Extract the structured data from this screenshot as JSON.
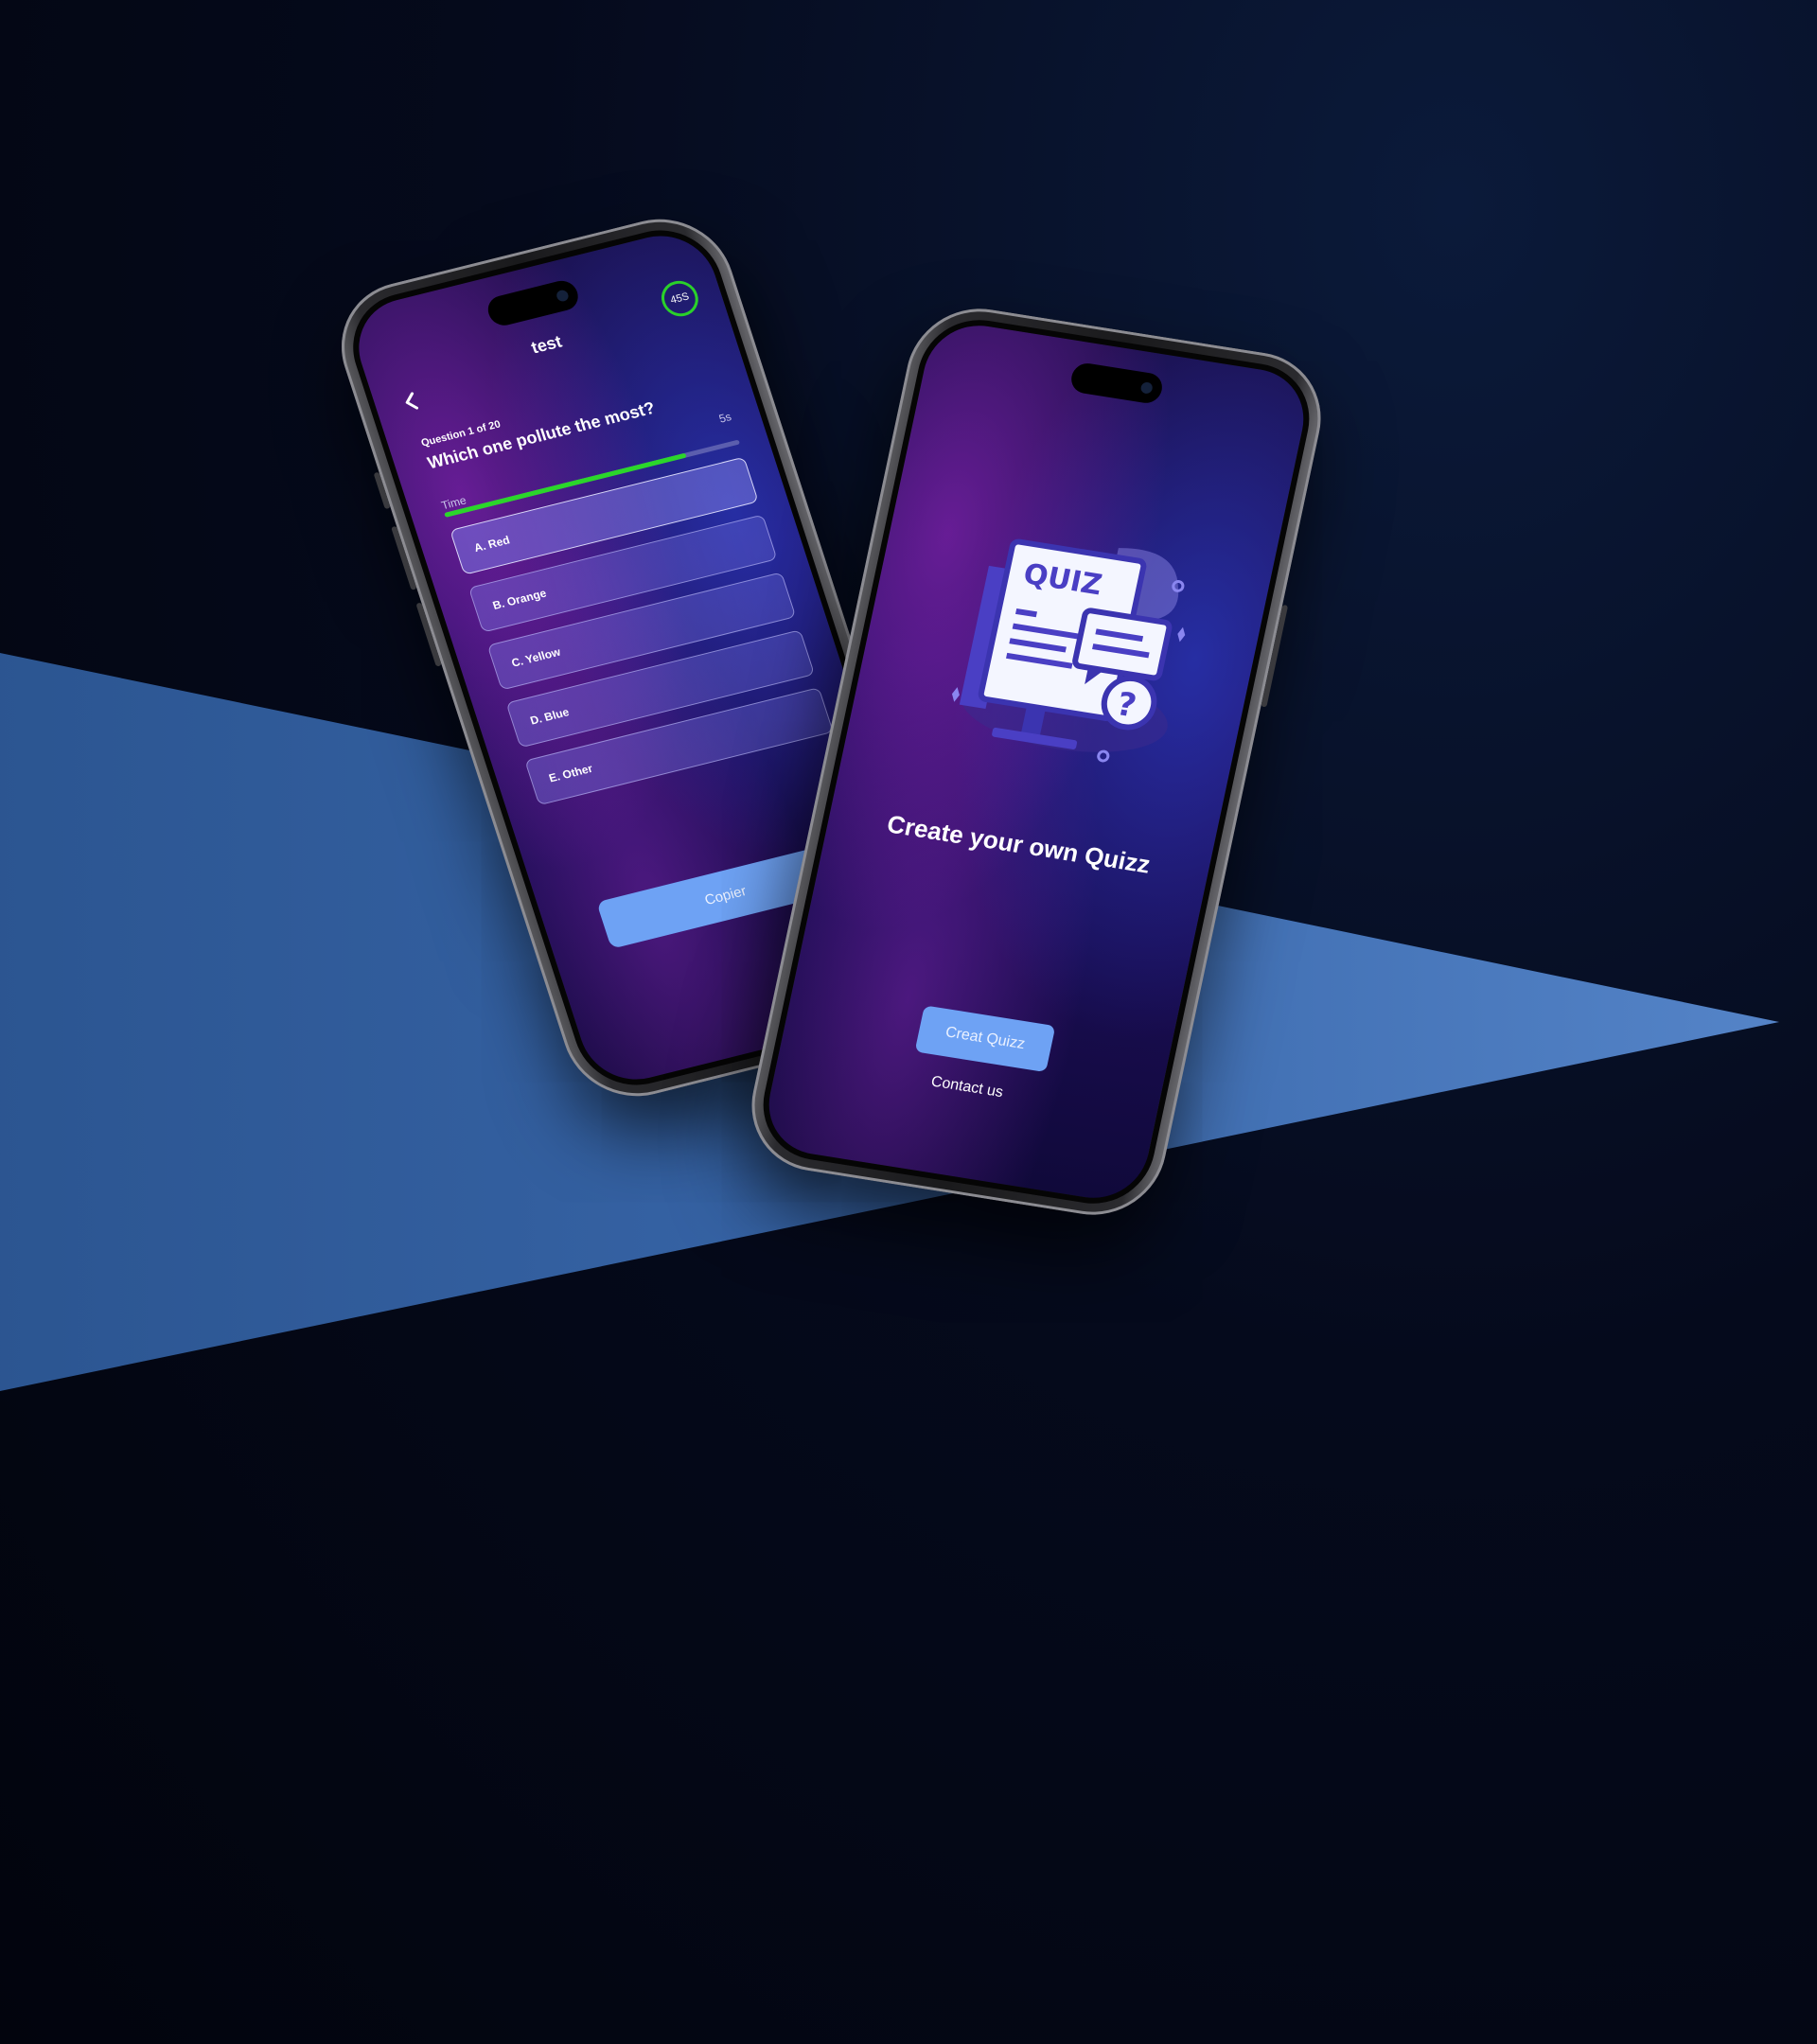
{
  "quiz_screen": {
    "title": "test",
    "timer_badge": "45S",
    "question_counter": "Question 1 of 20",
    "question_text": "Which one pollute the most?",
    "time_label": "Time",
    "time_seconds": "5s",
    "time_progress": 0.82,
    "options": [
      "A. Red",
      "B. Orange",
      "C. Yellow",
      "D. Blue",
      "E. Other"
    ],
    "selected_index": 0,
    "submit_label": "Copier"
  },
  "create_screen": {
    "illustration_text": "QUIZ",
    "heading": "Create your own Quizz",
    "primary_button": "Creat Quizz",
    "secondary_link": "Contact us"
  },
  "colors": {
    "accent_button": "#6ea2f4",
    "timer_green": "#2ad12a",
    "screen_purple": "#241060"
  }
}
